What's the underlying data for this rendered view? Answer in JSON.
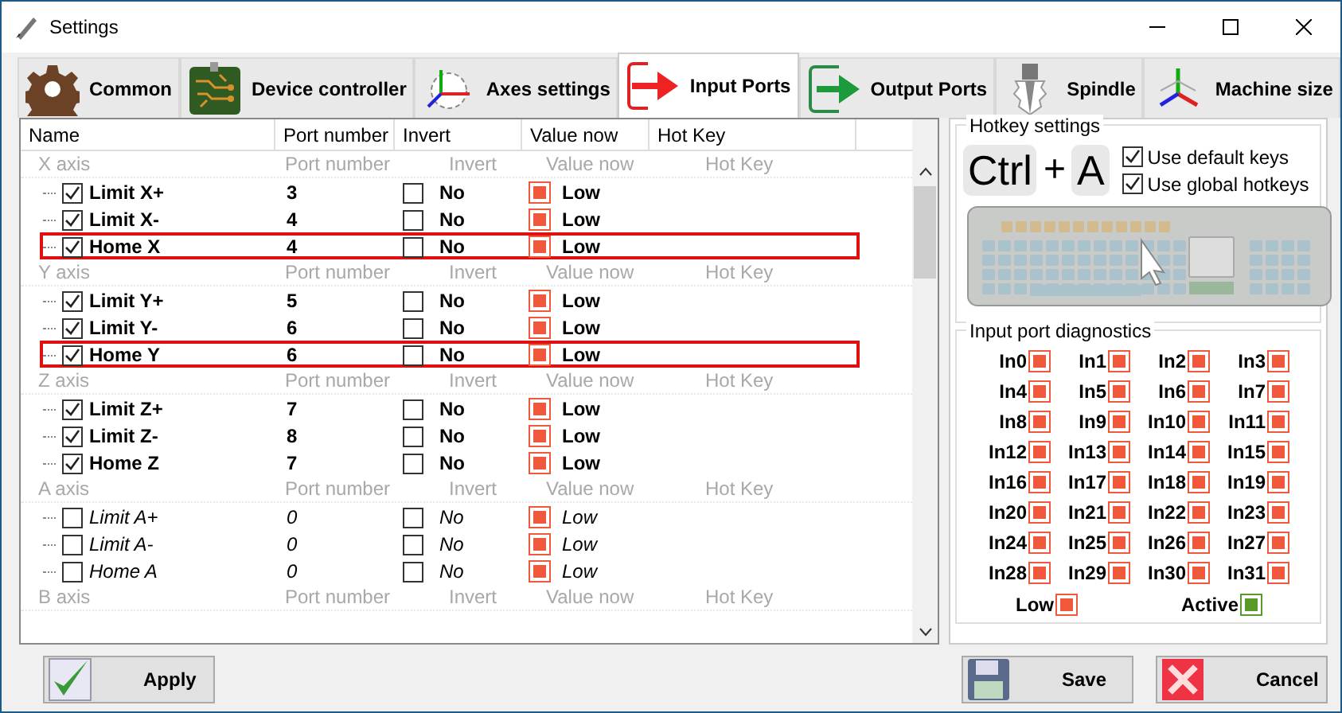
{
  "window": {
    "title": "Settings"
  },
  "tabs": [
    {
      "label": "Common",
      "selected": false
    },
    {
      "label": "Device controller",
      "selected": false
    },
    {
      "label": "Axes settings",
      "selected": false
    },
    {
      "label": "Input Ports",
      "selected": true
    },
    {
      "label": "Output Ports",
      "selected": false
    },
    {
      "label": "Spindle",
      "selected": false
    },
    {
      "label": "Machine size",
      "selected": false
    }
  ],
  "table": {
    "columns": [
      "Name",
      "Port number",
      "Invert",
      "Value now",
      "Hot Key"
    ],
    "groups": [
      {
        "name": "X axis",
        "headers": [
          "Port number",
          "Invert",
          "Value now",
          "Hot Key"
        ],
        "items": [
          {
            "name": "Limit X+",
            "checked": true,
            "enabled": true,
            "highlighted": false,
            "port": "3",
            "invert_checked": false,
            "invert": "No",
            "active": false,
            "value": "Low"
          },
          {
            "name": "Limit X-",
            "checked": true,
            "enabled": true,
            "highlighted": false,
            "port": "4",
            "invert_checked": false,
            "invert": "No",
            "active": false,
            "value": "Low"
          },
          {
            "name": "Home X",
            "checked": true,
            "enabled": true,
            "highlighted": true,
            "port": "4",
            "invert_checked": false,
            "invert": "No",
            "active": false,
            "value": "Low"
          }
        ]
      },
      {
        "name": "Y axis",
        "headers": [
          "Port number",
          "Invert",
          "Value now",
          "Hot Key"
        ],
        "items": [
          {
            "name": "Limit Y+",
            "checked": true,
            "enabled": true,
            "highlighted": false,
            "port": "5",
            "invert_checked": false,
            "invert": "No",
            "active": false,
            "value": "Low"
          },
          {
            "name": "Limit Y-",
            "checked": true,
            "enabled": true,
            "highlighted": false,
            "port": "6",
            "invert_checked": false,
            "invert": "No",
            "active": false,
            "value": "Low"
          },
          {
            "name": "Home Y",
            "checked": true,
            "enabled": true,
            "highlighted": true,
            "port": "6",
            "invert_checked": false,
            "invert": "No",
            "active": false,
            "value": "Low"
          }
        ]
      },
      {
        "name": "Z axis",
        "headers": [
          "Port number",
          "Invert",
          "Value now",
          "Hot Key"
        ],
        "items": [
          {
            "name": "Limit Z+",
            "checked": true,
            "enabled": true,
            "highlighted": false,
            "port": "7",
            "invert_checked": false,
            "invert": "No",
            "active": false,
            "value": "Low"
          },
          {
            "name": "Limit Z-",
            "checked": true,
            "enabled": true,
            "highlighted": false,
            "port": "8",
            "invert_checked": false,
            "invert": "No",
            "active": false,
            "value": "Low"
          },
          {
            "name": "Home Z",
            "checked": true,
            "enabled": true,
            "highlighted": false,
            "port": "7",
            "invert_checked": false,
            "invert": "No",
            "active": false,
            "value": "Low"
          }
        ]
      },
      {
        "name": "A axis",
        "headers": [
          "Port number",
          "Invert",
          "Value now",
          "Hot Key"
        ],
        "items": [
          {
            "name": "Limit A+",
            "checked": false,
            "enabled": false,
            "highlighted": false,
            "port": "0",
            "invert_checked": false,
            "invert": "No",
            "active": false,
            "value": "Low"
          },
          {
            "name": "Limit A-",
            "checked": false,
            "enabled": false,
            "highlighted": false,
            "port": "0",
            "invert_checked": false,
            "invert": "No",
            "active": false,
            "value": "Low"
          },
          {
            "name": "Home A",
            "checked": false,
            "enabled": false,
            "highlighted": false,
            "port": "0",
            "invert_checked": false,
            "invert": "No",
            "active": false,
            "value": "Low"
          }
        ]
      },
      {
        "name": "B axis",
        "headers": [
          "Port number",
          "Invert",
          "Value now",
          "Hot Key"
        ]
      }
    ]
  },
  "hotkeys": {
    "title": "Hotkey settings",
    "keys": [
      "Ctrl",
      "+",
      "A"
    ],
    "options": [
      {
        "label": "Use default keys",
        "checked": true
      },
      {
        "label": "Use global hotkeys",
        "checked": true
      }
    ]
  },
  "diagnostics": {
    "title": "Input port diagnostics",
    "inputs": [
      {
        "label": "In0",
        "active": false
      },
      {
        "label": "In1",
        "active": false
      },
      {
        "label": "In2",
        "active": false
      },
      {
        "label": "In3",
        "active": false
      },
      {
        "label": "In4",
        "active": false
      },
      {
        "label": "In5",
        "active": false
      },
      {
        "label": "In6",
        "active": false
      },
      {
        "label": "In7",
        "active": false
      },
      {
        "label": "In8",
        "active": false
      },
      {
        "label": "In9",
        "active": false
      },
      {
        "label": "In10",
        "active": false
      },
      {
        "label": "In11",
        "active": false
      },
      {
        "label": "In12",
        "active": false
      },
      {
        "label": "In13",
        "active": false
      },
      {
        "label": "In14",
        "active": false
      },
      {
        "label": "In15",
        "active": false
      },
      {
        "label": "In16",
        "active": false
      },
      {
        "label": "In17",
        "active": false
      },
      {
        "label": "In18",
        "active": false
      },
      {
        "label": "In19",
        "active": false
      },
      {
        "label": "In20",
        "active": false
      },
      {
        "label": "In21",
        "active": false
      },
      {
        "label": "In22",
        "active": false
      },
      {
        "label": "In23",
        "active": false
      },
      {
        "label": "In24",
        "active": false
      },
      {
        "label": "In25",
        "active": false
      },
      {
        "label": "In26",
        "active": false
      },
      {
        "label": "In27",
        "active": false
      },
      {
        "label": "In28",
        "active": false
      },
      {
        "label": "In29",
        "active": false
      },
      {
        "label": "In30",
        "active": false
      },
      {
        "label": "In31",
        "active": false
      }
    ],
    "legend": [
      {
        "label": "Low",
        "active": false
      },
      {
        "label": "Active",
        "active": true
      }
    ]
  },
  "buttons": [
    {
      "label": "Apply",
      "kind": "apply"
    },
    {
      "label": "Save",
      "kind": "save"
    },
    {
      "label": "Cancel",
      "kind": "cancel"
    }
  ]
}
